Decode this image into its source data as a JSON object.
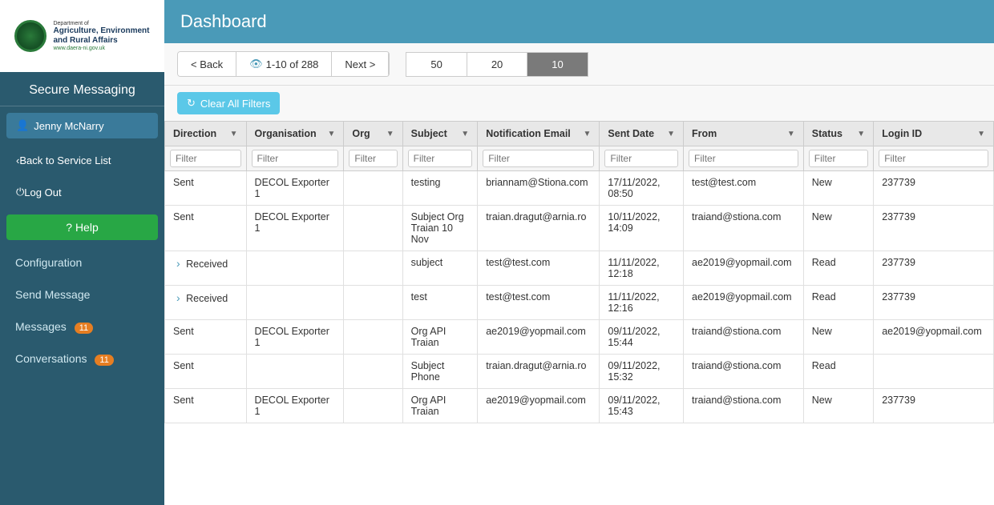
{
  "sidebar": {
    "title": "Secure Messaging",
    "user": {
      "name": "Jenny McNarry",
      "icon": "👤"
    },
    "back_label": "Back to Service List",
    "logout_label": "Log Out",
    "help_label": "? Help",
    "nav_items": [
      {
        "id": "configuration",
        "label": "Configuration",
        "badge": null,
        "active": false
      },
      {
        "id": "send-message",
        "label": "Send Message",
        "badge": null,
        "active": false
      },
      {
        "id": "messages",
        "label": "Messages",
        "badge": "11",
        "active": false
      },
      {
        "id": "conversations",
        "label": "Conversations",
        "badge": "11",
        "active": false
      }
    ]
  },
  "header": {
    "title": "Dashboard"
  },
  "toolbar": {
    "back_label": "< Back",
    "page_info": "1-10 of 288",
    "next_label": "Next >",
    "page_sizes": [
      "50",
      "20",
      "10"
    ],
    "active_page_size": "10",
    "clear_filters_label": "Clear All Filters"
  },
  "table": {
    "columns": [
      {
        "id": "direction",
        "label": "Direction",
        "filterable": true
      },
      {
        "id": "organisation",
        "label": "Organisation",
        "filterable": true
      },
      {
        "id": "org",
        "label": "Org",
        "filterable": true
      },
      {
        "id": "subject",
        "label": "Subject",
        "filterable": true
      },
      {
        "id": "notification_email",
        "label": "Notification Email",
        "filterable": true
      },
      {
        "id": "sent_date",
        "label": "Sent Date",
        "filterable": true
      },
      {
        "id": "from",
        "label": "From",
        "filterable": true
      },
      {
        "id": "status",
        "label": "Status",
        "filterable": true
      },
      {
        "id": "login_id",
        "label": "Login ID",
        "filterable": true
      }
    ],
    "rows": [
      {
        "expandable": false,
        "direction": "Sent",
        "organisation": "DECOL Exporter 1",
        "org": "",
        "subject": "testing",
        "notification_email": "briannam@Stiona.com",
        "sent_date": "17/11/2022, 08:50",
        "from": "test@test.com",
        "status": "New",
        "login_id": "237739"
      },
      {
        "expandable": false,
        "direction": "Sent",
        "organisation": "DECOL Exporter 1",
        "org": "",
        "subject": "Subject Org Traian 10 Nov",
        "notification_email": "traian.dragut@arnia.ro",
        "sent_date": "10/11/2022, 14:09",
        "from": "traiand@stiona.com",
        "status": "New",
        "login_id": "237739"
      },
      {
        "expandable": true,
        "direction": "Received",
        "organisation": "",
        "org": "",
        "subject": "subject",
        "notification_email": "test@test.com",
        "sent_date": "11/11/2022, 12:18",
        "from": "ae2019@yopmail.com",
        "status": "Read",
        "login_id": "237739"
      },
      {
        "expandable": true,
        "direction": "Received",
        "organisation": "",
        "org": "",
        "subject": "test",
        "notification_email": "test@test.com",
        "sent_date": "11/11/2022, 12:16",
        "from": "ae2019@yopmail.com",
        "status": "Read",
        "login_id": "237739"
      },
      {
        "expandable": false,
        "direction": "Sent",
        "organisation": "DECOL Exporter 1",
        "org": "",
        "subject": "Org API Traian",
        "notification_email": "ae2019@yopmail.com",
        "sent_date": "09/11/2022, 15:44",
        "from": "traiand@stiona.com",
        "status": "New",
        "login_id": "ae2019@yopmail.com"
      },
      {
        "expandable": false,
        "direction": "Sent",
        "organisation": "",
        "org": "",
        "subject": "Subject Phone",
        "notification_email": "traian.dragut@arnia.ro",
        "sent_date": "09/11/2022, 15:32",
        "from": "traiand@stiona.com",
        "status": "Read",
        "login_id": ""
      },
      {
        "expandable": false,
        "direction": "Sent",
        "organisation": "DECOL Exporter 1",
        "org": "",
        "subject": "Org API Traian",
        "notification_email": "ae2019@yopmail.com",
        "sent_date": "09/11/2022, 15:43",
        "from": "traiand@stiona.com",
        "status": "New",
        "login_id": "237739"
      }
    ]
  }
}
